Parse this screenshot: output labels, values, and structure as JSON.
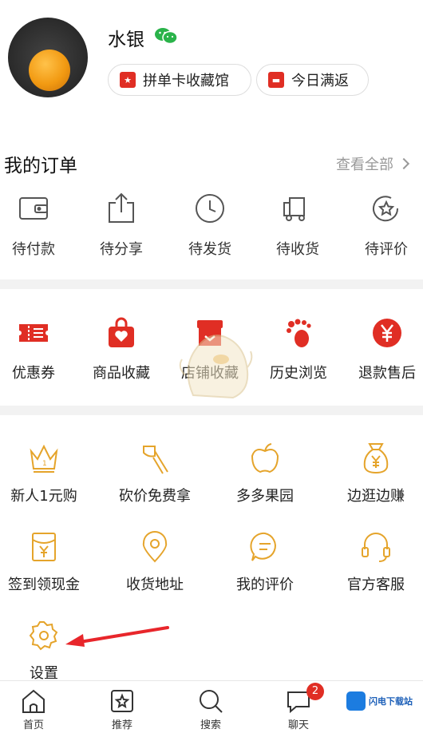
{
  "profile": {
    "username": "水银",
    "buttons": [
      {
        "label": "拼单卡收藏馆",
        "icon": "card-icon"
      },
      {
        "label": "今日满返",
        "icon": "red-envelope-icon"
      }
    ]
  },
  "orders": {
    "title": "我的订单",
    "view_all": "查看全部",
    "items": [
      {
        "label": "待付款",
        "icon": "wallet-icon"
      },
      {
        "label": "待分享",
        "icon": "share-icon"
      },
      {
        "label": "待发货",
        "icon": "clock-icon"
      },
      {
        "label": "待收货",
        "icon": "truck-icon"
      },
      {
        "label": "待评价",
        "icon": "review-icon"
      }
    ]
  },
  "quick_links": {
    "items": [
      {
        "label": "优惠券",
        "icon": "coupon-icon"
      },
      {
        "label": "商品收藏",
        "icon": "bag-heart-icon"
      },
      {
        "label": "店铺收藏",
        "icon": "store-icon"
      },
      {
        "label": "历史浏览",
        "icon": "footprint-icon"
      },
      {
        "label": "退款售后",
        "icon": "yuan-icon"
      }
    ]
  },
  "services": {
    "items": [
      {
        "label": "新人1元购",
        "icon": "crown-icon"
      },
      {
        "label": "砍价免费拿",
        "icon": "axe-icon"
      },
      {
        "label": "多多果园",
        "icon": "apple-icon"
      },
      {
        "label": "边逛边赚",
        "icon": "money-bag-icon"
      },
      {
        "label": "签到领现金",
        "icon": "cash-envelope-icon"
      },
      {
        "label": "收货地址",
        "icon": "location-icon"
      },
      {
        "label": "我的评价",
        "icon": "comment-icon"
      },
      {
        "label": "官方客服",
        "icon": "headset-icon"
      },
      {
        "label": "设置",
        "icon": "gear-icon"
      }
    ]
  },
  "bottom_nav": {
    "items": [
      {
        "label": "首页",
        "icon": "home-icon"
      },
      {
        "label": "推荐",
        "icon": "recommend-icon"
      },
      {
        "label": "搜索",
        "icon": "search-icon"
      },
      {
        "label": "聊天",
        "icon": "chat-icon"
      }
    ],
    "chat_badge": "2"
  },
  "watermark": {
    "text": "闪电下载站"
  },
  "colors": {
    "accent": "#e02e24",
    "service_icon": "#e5a42b",
    "divider": "#f2f2f2"
  }
}
